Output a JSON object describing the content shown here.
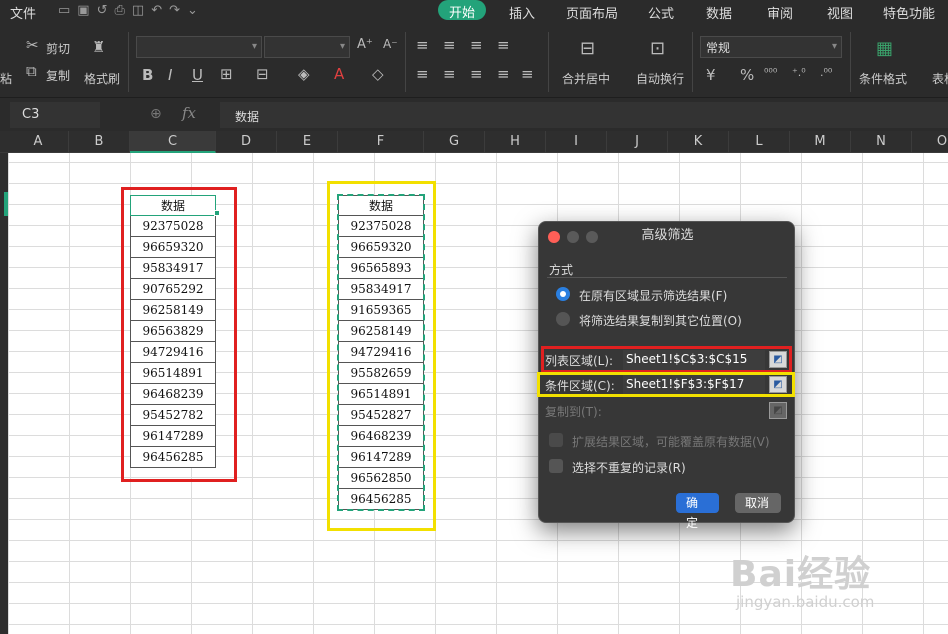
{
  "menu": {
    "file": "文件",
    "tabs": [
      "开始",
      "插入",
      "页面布局",
      "公式",
      "数据",
      "审阅",
      "视图",
      "特色功能"
    ],
    "active_tab": "开始"
  },
  "ribbon": {
    "paste": "粘",
    "cut": "剪切",
    "copy": "复制",
    "format_painter": "格式刷",
    "merge_center": "合并居中",
    "wrap_text": "自动换行",
    "number_format": "常规",
    "conditional_format": "条件格式",
    "table_style": "表格"
  },
  "formula_bar": {
    "cell_ref": "C3",
    "fx": "fx",
    "content": "数据"
  },
  "columns": [
    "A",
    "B",
    "C",
    "D",
    "E",
    "F",
    "G",
    "H",
    "I",
    "J",
    "K",
    "L",
    "M",
    "N",
    "O"
  ],
  "selected_column": "C",
  "list_range": {
    "header": "数据",
    "values": [
      "92375028",
      "96659320",
      "95834917",
      "90765292",
      "96258149",
      "96563829",
      "94729416",
      "96514891",
      "96468239",
      "95452782",
      "96147289",
      "96456285"
    ]
  },
  "criteria_range": {
    "header": "数据",
    "values": [
      "92375028",
      "96659320",
      "96565893",
      "95834917",
      "91659365",
      "96258149",
      "94729416",
      "95582659",
      "96514891",
      "95452827",
      "96468239",
      "96147289",
      "96562850",
      "96456285"
    ]
  },
  "dialog": {
    "title": "高级筛选",
    "mode_label": "方式",
    "option_in_place": "在原有区域显示筛选结果(F)",
    "option_copy": "将筛选结果复制到其它位置(O)",
    "list_range_label": "列表区域(L):",
    "list_range_value": "Sheet1!$C$3:$C$15",
    "criteria_label": "条件区域(C):",
    "criteria_value": "Sheet1!$F$3:$F$17",
    "copy_to_label": "复制到(T):",
    "expand_label": "扩展结果区域，可能覆盖原有数据(V)",
    "unique_label": "选择不重复的记录(R)",
    "ok": "确定",
    "cancel": "取消"
  },
  "watermark": {
    "brand": "Bai经验",
    "url": "jingyan.baidu.com"
  },
  "colors": {
    "accent": "#23a37a",
    "red_highlight": "#e02020",
    "yellow_highlight": "#f2e000",
    "ok_button": "#2a6fd6"
  }
}
